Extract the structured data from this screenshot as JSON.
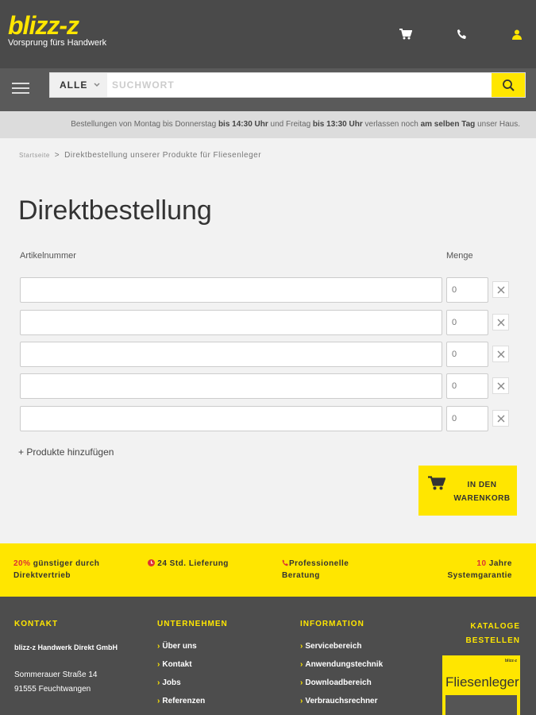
{
  "header": {
    "logo_text": "blizz-z",
    "tagline": "Vorsprung fürs Handwerk",
    "icons": [
      "cart-icon",
      "phone-icon",
      "user-icon"
    ]
  },
  "search": {
    "category_label": "ALLE",
    "placeholder": "SUCHWORT"
  },
  "notice": {
    "part1": "Bestellungen von Montag bis Donnerstag ",
    "time1": "bis 14:30 Uhr",
    "part2": " und Freitag ",
    "time2": "bis 13:30 Uhr",
    "part3": " verlassen noch ",
    "same_day": "am selben Tag",
    "part4": " unser Haus."
  },
  "breadcrumb": {
    "home": "Startseite",
    "separator": ">",
    "current": "Direktbestellung unserer Produkte für Fliesenleger"
  },
  "page": {
    "title": "Direktbestellung",
    "col_article": "Artikelnummer",
    "col_quantity": "Menge"
  },
  "rows": [
    {
      "article": "",
      "quantity": "0"
    },
    {
      "article": "",
      "quantity": "0"
    },
    {
      "article": "",
      "quantity": "0"
    },
    {
      "article": "",
      "quantity": "0"
    },
    {
      "article": "",
      "quantity": "0"
    }
  ],
  "actions": {
    "add_products": "+ Produkte hinzufügen",
    "to_cart_line1": "IN DEN",
    "to_cart_line2": "WARENKORB"
  },
  "usp": {
    "item1_highlight": "20%",
    "item1_rest": " günstiger durch",
    "item1_line2": "Direktvertrieb",
    "item2": "24 Std. Lieferung",
    "item3_line1": "Professionelle",
    "item3_line2": "Beratung",
    "item4_highlight": "10",
    "item4_rest": " Jahre",
    "item4_line2": "Systemgarantie"
  },
  "footer": {
    "contact_head": "KONTAKT",
    "company": "blizz-z Handwerk Direkt GmbH",
    "street": "Sommerauer Straße 14",
    "city": "91555 Feuchtwangen",
    "company_head": "UNTERNEHMEN",
    "company_links": [
      "Über uns",
      "Kontakt",
      "Jobs",
      "Referenzen"
    ],
    "info_head": "INFORMATION",
    "info_links": [
      "Servicebereich",
      "Anwendungstechnik",
      "Downloadbereich",
      "Verbrauchsrechner"
    ],
    "catalog_head_line1": "KATALOGE",
    "catalog_head_line2": "BESTELLEN",
    "catalog_title": "Fliesenleger",
    "catalog_brand": "blizz-z"
  },
  "colors": {
    "accent": "#ffe600",
    "header_bg": "#4a4a4a",
    "footer_bg": "#4d4d4d",
    "highlight_red": "#dd3333"
  }
}
